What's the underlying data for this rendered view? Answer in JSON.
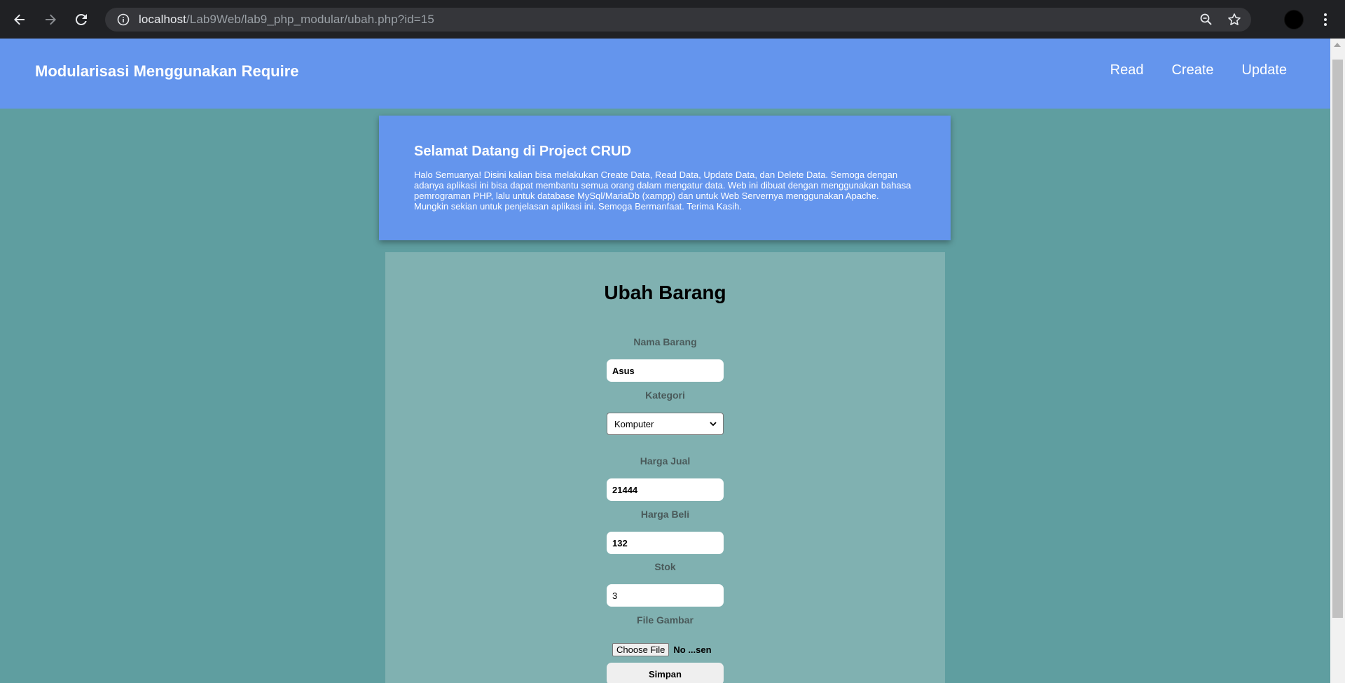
{
  "browser": {
    "url_host": "localhost",
    "url_path": "/Lab9Web/lab9_php_modular/ubah.php?id=15"
  },
  "header": {
    "title": "Modularisasi Menggunakan Require",
    "nav": [
      "Read",
      "Create",
      "Update"
    ]
  },
  "welcome": {
    "heading": "Selamat Datang di Project CRUD",
    "body": "Halo Semuanya! Disini kalian bisa melakukan Create Data, Read Data, Update Data, dan Delete Data. Semoga dengan adanya aplikasi ini bisa dapat membantu semua orang dalam mengatur data. Web ini dibuat dengan menggunakan bahasa pemrograman PHP, lalu untuk database MySql/MariaDb (xampp) dan untuk Web Servernya menggunakan Apache. Mungkin sekian untuk penjelasan aplikasi ini. Semoga Bermanfaat. Terima Kasih."
  },
  "form": {
    "title": "Ubah Barang",
    "nama_label": "Nama Barang",
    "nama_value": "Asus",
    "kategori_label": "Kategori",
    "kategori_value": "Komputer",
    "harga_jual_label": "Harga Jual",
    "harga_jual_value": "21444",
    "harga_beli_label": "Harga Beli",
    "harga_beli_value": "132",
    "stok_label": "Stok",
    "stok_value": "3",
    "file_label": "File Gambar",
    "file_button": "Choose File",
    "file_status": "No ...sen",
    "submit_label": "Simpan"
  },
  "colors": {
    "page_bg": "#5f9ea0",
    "header_bg": "#6495ed",
    "form_bg": "#80b1b1"
  }
}
